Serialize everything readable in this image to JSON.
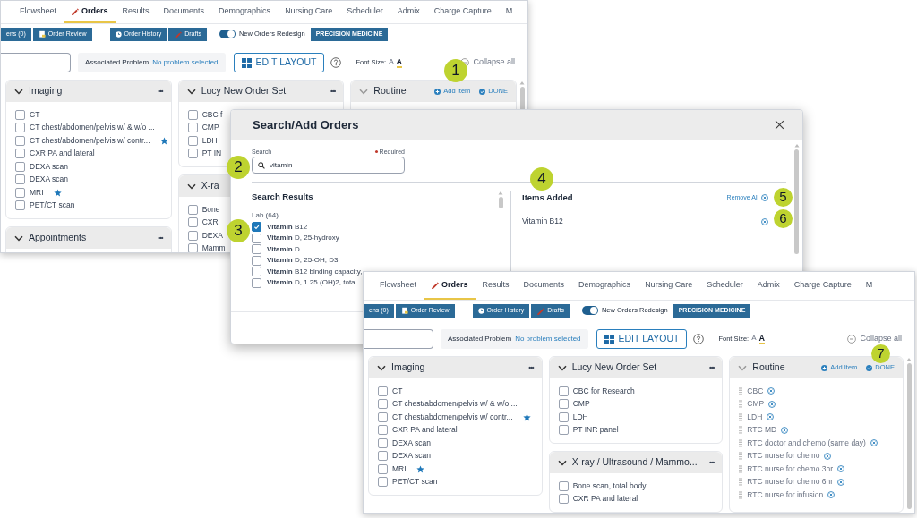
{
  "orders_window_back": {
    "tabs": [
      {
        "label": "Flowsheet",
        "selected": false
      },
      {
        "label": "Orders",
        "selected": true
      },
      {
        "label": "Results",
        "selected": false
      },
      {
        "label": "Documents",
        "selected": false
      },
      {
        "label": "Demographics",
        "selected": false
      },
      {
        "label": "Nursing Care",
        "selected": false
      },
      {
        "label": "Scheduler",
        "selected": false
      },
      {
        "label": "Admix",
        "selected": false
      },
      {
        "label": "Charge Capture",
        "selected": false
      },
      {
        "label": "M",
        "selected": false
      }
    ],
    "toolbar": {
      "buttons": [
        "ens (0)",
        "Order Review",
        "Order History",
        "Drafts"
      ],
      "toggle": {
        "label": "New Orders Redesign",
        "on": true
      },
      "tag_button": "PRECISION MEDICINE"
    },
    "problem_bar": {
      "label": "Associated Problem",
      "value": "No problem selected",
      "edit_button": "EDIT LAYOUT",
      "font_size": {
        "label": "Font Size:",
        "options": [
          {
            "label": "A",
            "selected": false
          },
          {
            "label": "A",
            "selected": true
          }
        ]
      },
      "collapse": "Collapse all"
    },
    "columns": [
      [
        {
          "kind": "checklist",
          "title": "Imaging",
          "menu": "•••",
          "items": [
            {
              "label": "CT",
              "checked": false,
              "starred": false
            },
            {
              "label": "CT chest/abdomen/pelvis w/ & w/o ...",
              "checked": false,
              "starred": false
            },
            {
              "label": "CT chest/abdomen/pelvis w/ contr...",
              "checked": false,
              "starred": true
            },
            {
              "label": "CXR PA and lateral",
              "checked": false,
              "starred": false
            },
            {
              "label": "DEXA scan",
              "checked": false,
              "starred": false
            },
            {
              "label": "DEXA scan",
              "checked": false,
              "starred": false
            },
            {
              "label": "MRI",
              "checked": false,
              "starred": true
            },
            {
              "label": "PET/CT scan",
              "checked": false,
              "starred": false
            }
          ]
        },
        {
          "kind": "checklist",
          "title": "Appointments",
          "menu": "•••"
        }
      ],
      [
        {
          "kind": "checklist",
          "title": "Lucy New Order Set",
          "menu": "•••",
          "items": [
            {
              "label": "CBC f",
              "checked": false,
              "starred": false
            },
            {
              "label": "CMP",
              "checked": false,
              "starred": false
            },
            {
              "label": "LDH",
              "checked": false,
              "starred": false
            },
            {
              "label": "PT IN",
              "checked": false,
              "starred": false
            }
          ]
        },
        {
          "kind": "checklist",
          "title": "X-ra",
          "items": [
            {
              "label": "Bone",
              "checked": false,
              "starred": false
            },
            {
              "label": "CXR",
              "checked": false,
              "starred": false
            },
            {
              "label": "DEXA",
              "checked": false,
              "starred": false
            },
            {
              "label": "Mamm",
              "checked": false,
              "starred": false
            }
          ]
        }
      ],
      [
        {
          "kind": "editing",
          "title": "Routine",
          "actions": [
            "Add Item",
            "DONE"
          ]
        }
      ]
    ]
  },
  "search_dialog": {
    "title": "Search/Add Orders",
    "search": {
      "label": "Search",
      "required": "Required",
      "value": "vitamin"
    },
    "results": {
      "title": "Search Results",
      "group": "Lab (64)",
      "items": [
        {
          "label": "**Vitamin** B12",
          "checked": true
        },
        {
          "label": "**Vitamin** D, 25-hydroxy",
          "checked": false
        },
        {
          "label": "**Vitamin** D",
          "checked": false
        },
        {
          "label": "**Vitamin** D, 25-OH, D3",
          "checked": false
        },
        {
          "label": "**Vitamin** B12 binding capacity,",
          "checked": false
        },
        {
          "label": "**Vitamin** D, 1.25 (OH)2, total",
          "checked": false
        }
      ]
    },
    "added": {
      "title": "Items Added",
      "remove_all": "Remove All",
      "items": [
        "Vitamin B12"
      ]
    }
  },
  "orders_window_front": {
    "tabs": [
      {
        "label": "Flowsheet",
        "selected": false
      },
      {
        "label": "Orders",
        "selected": true
      },
      {
        "label": "Results",
        "selected": false
      },
      {
        "label": "Documents",
        "selected": false
      },
      {
        "label": "Demographics",
        "selected": false
      },
      {
        "label": "Nursing Care",
        "selected": false
      },
      {
        "label": "Scheduler",
        "selected": false
      },
      {
        "label": "Admix",
        "selected": false
      },
      {
        "label": "Charge Capture",
        "selected": false
      },
      {
        "label": "M",
        "selected": false
      }
    ],
    "toolbar": {
      "buttons": [
        "ens (0)",
        "Order Review",
        "Order History",
        "Drafts"
      ],
      "toggle": {
        "label": "New Orders Redesign",
        "on": true
      },
      "tag_button": "PRECISION MEDICINE"
    },
    "problem_bar": {
      "label": "Associated Problem",
      "value": "No problem selected",
      "edit_button": "EDIT LAYOUT",
      "font_size": {
        "label": "Font Size:",
        "options": [
          {
            "label": "A",
            "selected": false
          },
          {
            "label": "A",
            "selected": true
          }
        ]
      },
      "collapse": "Collapse all"
    },
    "columns": [
      [
        {
          "kind": "checklist",
          "title": "Imaging",
          "menu": "•••",
          "items": [
            {
              "label": "CT",
              "checked": false,
              "starred": false
            },
            {
              "label": "CT chest/abdomen/pelvis w/ & w/o ...",
              "checked": false,
              "starred": false
            },
            {
              "label": "CT chest/abdomen/pelvis w/ contr...",
              "checked": false,
              "starred": true
            },
            {
              "label": "CXR PA and lateral",
              "checked": false,
              "starred": false
            },
            {
              "label": "DEXA scan",
              "checked": false,
              "starred": false
            },
            {
              "label": "DEXA scan",
              "checked": false,
              "starred": false
            },
            {
              "label": "MRI",
              "checked": false,
              "starred": true
            },
            {
              "label": "PET/CT scan",
              "checked": false,
              "starred": false
            }
          ]
        }
      ],
      [
        {
          "kind": "checklist",
          "title": "Lucy New Order Set",
          "menu": "•••",
          "items": [
            {
              "label": "CBC for Research",
              "checked": false,
              "starred": false
            },
            {
              "label": "CMP",
              "checked": false,
              "starred": false
            },
            {
              "label": "LDH",
              "checked": false,
              "starred": false
            },
            {
              "label": "PT INR panel",
              "checked": false,
              "starred": false
            }
          ]
        },
        {
          "kind": "checklist",
          "title": "X-ray / Ultrasound / Mammo...",
          "menu": "•••",
          "items": [
            {
              "label": "Bone scan, total body",
              "checked": false,
              "starred": false
            },
            {
              "label": "CXR PA and lateral",
              "checked": false,
              "starred": false
            }
          ]
        }
      ],
      [
        {
          "kind": "editing",
          "title": "Routine",
          "actions": [
            "Add Item",
            "DONE"
          ],
          "items": [
            {
              "label": "CBC"
            },
            {
              "label": "CMP"
            },
            {
              "label": "LDH"
            },
            {
              "label": "RTC MD"
            },
            {
              "label": "RTC doctor and chemo (same day)"
            },
            {
              "label": "RTC nurse for chemo"
            },
            {
              "label": "RTC nurse for chemo 3hr"
            },
            {
              "label": "RTC nurse for chemo 6hr"
            },
            {
              "label": "RTC nurse for infusion"
            }
          ]
        }
      ]
    ]
  },
  "callouts": [
    "1",
    "2",
    "3",
    "4",
    "5",
    "6",
    "7"
  ]
}
